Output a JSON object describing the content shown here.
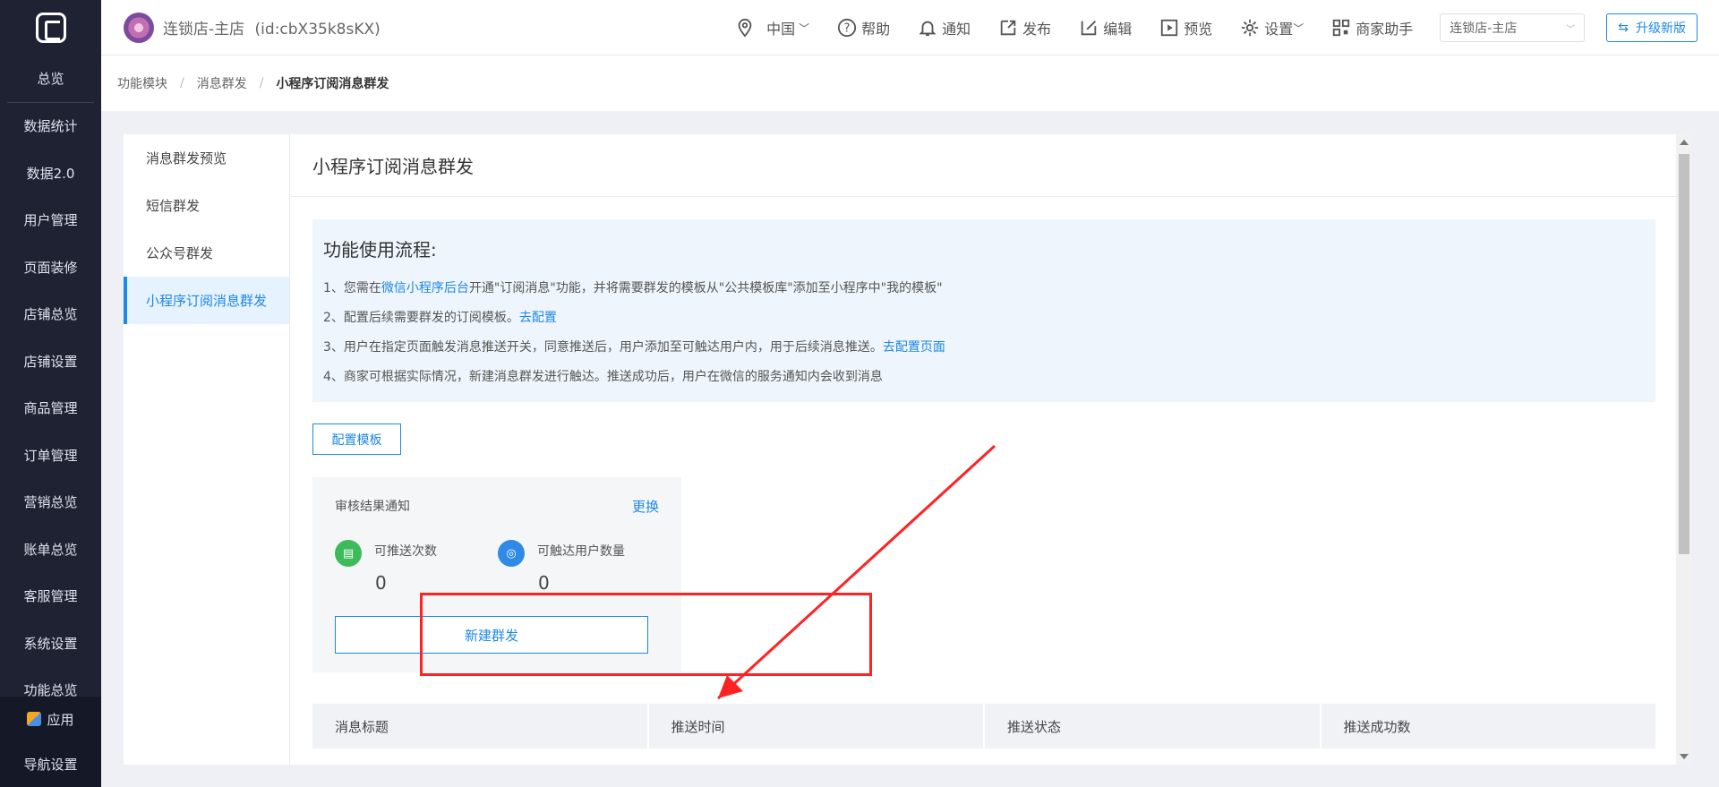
{
  "sidebar": {
    "items": [
      {
        "label": "总览"
      },
      {
        "label": "数据统计"
      },
      {
        "label": "数据2.0"
      },
      {
        "label": "用户管理"
      },
      {
        "label": "页面装修"
      },
      {
        "label": "店铺总览"
      },
      {
        "label": "店铺设置"
      },
      {
        "label": "商品管理"
      },
      {
        "label": "订单管理"
      },
      {
        "label": "营销总览"
      },
      {
        "label": "账单总览"
      },
      {
        "label": "客服管理"
      },
      {
        "label": "系统设置"
      },
      {
        "label": "功能总览"
      }
    ],
    "apps_label": "应用",
    "nav_settings_label": "导航设置"
  },
  "header": {
    "store_title": "连锁店-主店",
    "store_id": "(id:cbX35k8sKX)",
    "region": "中国",
    "help": "帮助",
    "notify": "通知",
    "publish": "发布",
    "edit": "编辑",
    "preview": "预览",
    "settings": "设置",
    "assistant": "商家助手",
    "store_select": "连锁店-主店",
    "upgrade": "升级新版"
  },
  "breadcrumb": {
    "items": [
      "功能模块",
      "消息群发",
      "小程序订阅消息群发"
    ]
  },
  "subnav": {
    "items": [
      {
        "label": "消息群发预览"
      },
      {
        "label": "短信群发"
      },
      {
        "label": "公众号群发"
      },
      {
        "label": "小程序订阅消息群发",
        "active": true
      }
    ]
  },
  "content": {
    "title": "小程序订阅消息群发",
    "flow": {
      "title": "功能使用流程:",
      "step1_pre": "1、您需在",
      "step1_link": "微信小程序后台",
      "step1_post": "开通\"订阅消息\"功能，并将需要群发的模板从\"公共模板库\"添加至小程序中\"我的模板\"",
      "step2_pre": "2、配置后续需要群发的订阅模板。",
      "step2_link": "去配置",
      "step3_pre": "3、用户在指定页面触发消息推送开关，同意推送后，用户添加至可触达用户内，用于后续消息推送。",
      "step3_link": "去配置页面",
      "step4": "4、商家可根据实际情况，新建消息群发进行触达。推送成功后，用户在微信的服务通知内会收到消息"
    },
    "config_button": "配置模板",
    "card": {
      "template_name": "审核结果通知",
      "change": "更换",
      "stat1_label": "可推送次数",
      "stat1_value": "0",
      "stat2_label": "可触达用户数量",
      "stat2_value": "0",
      "new_button": "新建群发"
    },
    "table": {
      "headers": [
        "消息标题",
        "推送时间",
        "推送状态",
        "推送成功数"
      ]
    }
  },
  "colors": {
    "accent": "#1e88e5",
    "sidebar_bg": "#1e2233",
    "annotation_red": "#ff2222"
  }
}
